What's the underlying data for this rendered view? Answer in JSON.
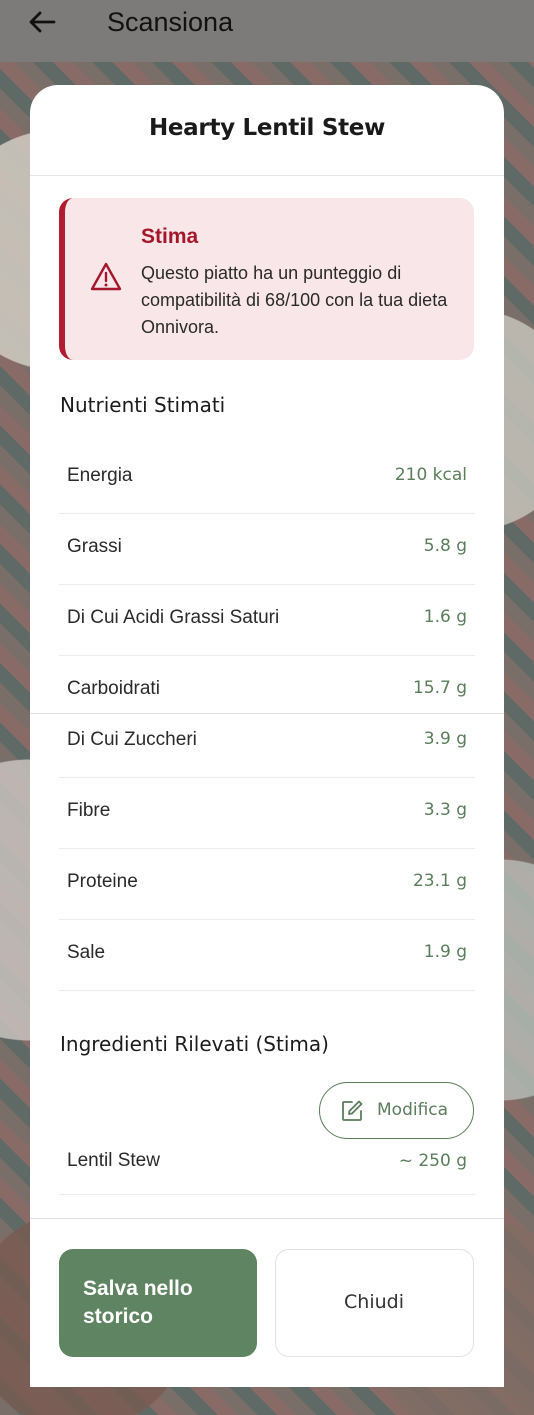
{
  "header": {
    "title": "Scansiona"
  },
  "dish": {
    "title": "Hearty Lentil Stew"
  },
  "alert": {
    "title": "Stima",
    "message": "Questo piatto ha un punteggio di compatibilità di 68/100 con la tua dieta Onnivora.",
    "icon": "warning-triangle-icon",
    "accent_color": "#b01c30",
    "background_color": "#f8e6e8"
  },
  "nutrients": {
    "section_title": "Nutrienti Stimati",
    "items": [
      {
        "name": "Energia",
        "value": "210 kcal"
      },
      {
        "name": "Grassi",
        "value": "5.8 g"
      },
      {
        "name": "Di Cui Acidi Grassi Saturi",
        "value": "1.6 g"
      },
      {
        "name": "Carboidrati",
        "value": "15.7 g"
      },
      {
        "name": "Di Cui Zuccheri",
        "value": "3.9 g"
      },
      {
        "name": "Fibre",
        "value": "3.3 g"
      },
      {
        "name": "Proteine",
        "value": "23.1 g"
      },
      {
        "name": "Sale",
        "value": "1.9 g"
      }
    ]
  },
  "ingredients": {
    "section_title": "Ingredienti Rilevati (Stima)",
    "edit_label": "Modifica",
    "items": [
      {
        "name": "Lentil Stew",
        "quantity": "~ 250 g"
      }
    ]
  },
  "actions": {
    "save_label": "Salva nello storico",
    "close_label": "Chiudi"
  },
  "colors": {
    "primary_green": "#5f8462",
    "value_green": "#5a7d5b",
    "alert_red": "#a4172b"
  }
}
